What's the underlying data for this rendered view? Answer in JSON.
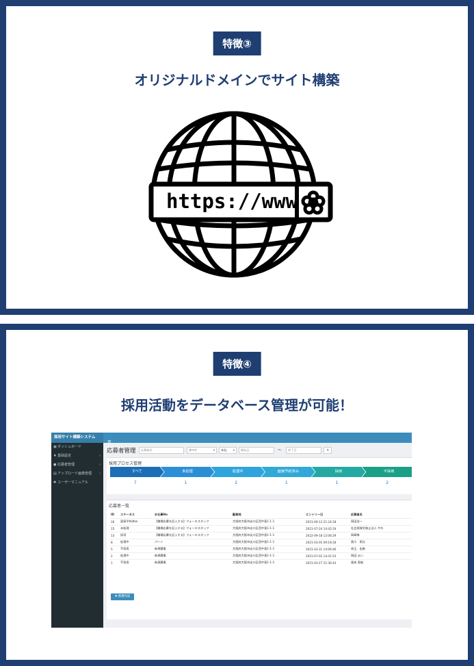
{
  "feature3": {
    "badge": "特徴③",
    "title": "オリジナルドメインでサイト構築",
    "url_text": "https://www",
    "icon": "globe-icon"
  },
  "feature4": {
    "badge": "特徴④",
    "title": "採用活動をデータベース管理が可能！",
    "screenshot": {
      "brand": "採用サイト構築システム",
      "menu_icon": "hamburger-icon",
      "nav": [
        {
          "icon": "dashboard-icon",
          "label": "ダッシュボード",
          "caret": false
        },
        {
          "icon": "pin-icon",
          "label": "基础設定",
          "caret": true
        },
        {
          "icon": "user-icon",
          "label": "応募者管理",
          "caret": true
        },
        {
          "icon": "upload-icon",
          "label": "アップロード画像管理",
          "caret": true
        },
        {
          "icon": "gear-icon",
          "label": "ユーザーマニュアル",
          "caret": false
        }
      ],
      "page_title": "応募者管理",
      "search": {
        "name_placeholder": "応募者名",
        "status_value": "すべて",
        "sort_value": "未社",
        "date_from_placeholder": "開始日",
        "date_sep": "〜",
        "date_to_placeholder": "終了日",
        "search_icon": "search-icon"
      },
      "process": {
        "title": "採用プロセス管理",
        "steps": [
          {
            "label": "すべて",
            "count": "7",
            "color": "#1c6fb7"
          },
          {
            "label": "未処理",
            "count": "1",
            "color": "#2b8fd6"
          },
          {
            "label": "処理中",
            "count": "2",
            "color": "#2fa3dc"
          },
          {
            "label": "面接予約済み",
            "count": "1",
            "color": "#31a9d8"
          },
          {
            "label": "採用",
            "count": "1",
            "color": "#23a9a1"
          },
          {
            "label": "不採用",
            "count": "2",
            "color": "#1aa086"
          }
        ]
      },
      "applicants": {
        "title": "応募者一覧",
        "columns": [
          "ID",
          "ステータス",
          "お仕事No",
          "勤務地",
          "エントリー日",
          "応募者名"
        ],
        "rows": [
          [
            "16",
            "面接予約済み",
            "【職場応募を記入する】フォーエスタッフ",
            "大阪府大阪市淀川区西中島1-1-1",
            "2021-09-13 21:24:18",
            "岡田浩一"
          ],
          [
            "15",
            "未処理",
            "【職場応募を記入する】フォーエスタッフ",
            "大阪府大阪市淀川区西中島1-1-1",
            "2021-07-24 14:42:19",
            "社会保険労務士法人 やわ"
          ],
          [
            "13",
            "採用",
            "【職場応募を記入する】フォーエスタッフ",
            "大阪府大阪市淀川区西中島1-1-1",
            "2022-09-18 12:06:29",
            "岡崎梅"
          ],
          [
            "8",
            "処理中",
            "パート",
            "大阪府大阪市淀川区西中島1-1-1",
            "2021-03-05 09:18:18",
            "奥川　照元"
          ],
          [
            "5",
            "不採用",
            "新規募集",
            "大阪府大阪市淀川区西中島1-1-1",
            "2021-03-31 14:06:46",
            "南玉　由香"
          ],
          [
            "2",
            "処理中",
            "新規募集",
            "大阪府大阪市淀川区西中島1-1-1",
            "2021-07-02 14:41:53",
            "岡田 まい"
          ],
          [
            "1",
            "不採用",
            "新規募集",
            "大阪府大阪市淀川区西中島1-1-1",
            "2021-03-27 21:36:43",
            "福本 直後"
          ]
        ],
        "new_button": "✚ 新規作成"
      }
    }
  }
}
